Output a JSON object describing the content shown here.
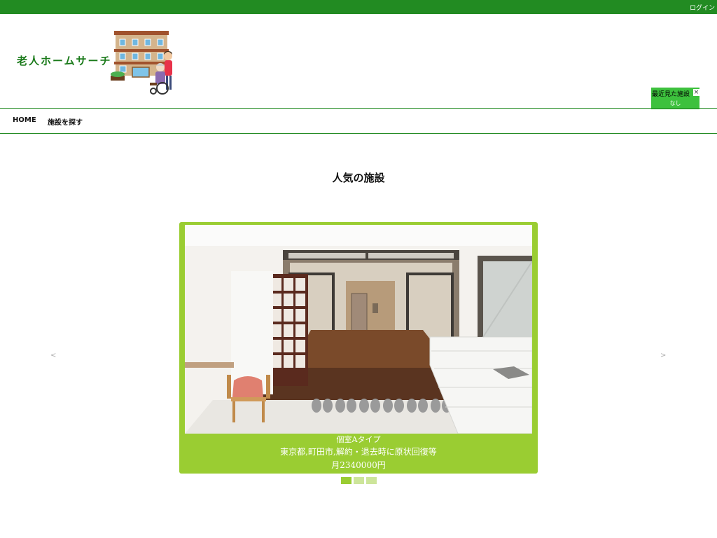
{
  "topbar": {
    "login_label": "ログイン"
  },
  "header": {
    "logo_text": "老人ホームサーチ"
  },
  "recently_viewed": {
    "title": "最近見た施設",
    "close_symbol": "×",
    "empty_text": "なし"
  },
  "nav": {
    "items": [
      {
        "label": "HOME"
      },
      {
        "label": "施設を探す"
      }
    ]
  },
  "section": {
    "title": "人気の施設"
  },
  "carousel": {
    "prev_symbol": "<",
    "next_symbol": ">",
    "slide": {
      "name": "個室Aタイプ",
      "address": "東京都,町田市,解約・退去時に原状回復等",
      "price": "月2340000円"
    },
    "dots": [
      {
        "active": true
      },
      {
        "active": false
      },
      {
        "active": false
      }
    ]
  },
  "colors": {
    "brand_green": "#228b22",
    "card_green": "#9acd32",
    "recent_green": "#3dc13d"
  }
}
